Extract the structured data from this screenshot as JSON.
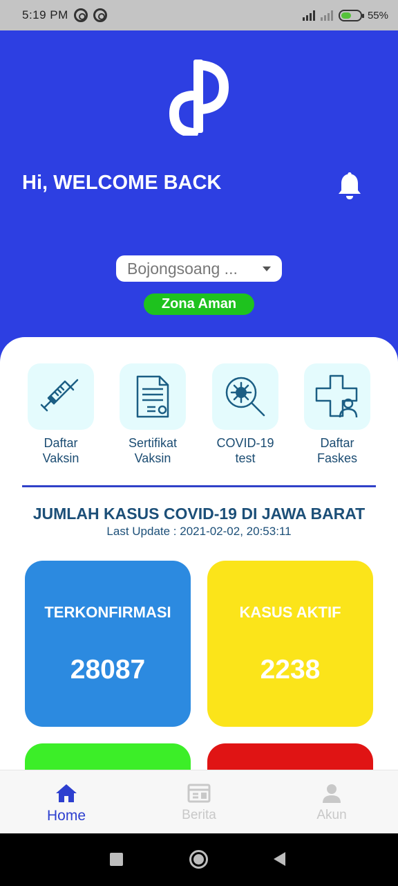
{
  "status_bar": {
    "time": "5:19 PM",
    "battery": "55%",
    "battery_level": 0.55
  },
  "hero": {
    "greeting": "Hi, WELCOME BACK",
    "location": "Bojongsoang ...",
    "zone_label": "Zona Aman",
    "colors": {
      "background": "#2d3fe2",
      "zone": "#1ec21e"
    }
  },
  "menu": [
    {
      "label": "Daftar\nVaksin",
      "icon": "syringe-icon"
    },
    {
      "label": "Sertifikat\nVaksin",
      "icon": "certificate-icon"
    },
    {
      "label": "COVID-19\ntest",
      "icon": "virus-search-icon"
    },
    {
      "label": "Daftar\nFaskes",
      "icon": "hospital-cross-icon"
    }
  ],
  "covid": {
    "title": "JUMLAH KASUS COVID-19 DI JAWA BARAT",
    "last_update": "Last Update : 2021-02-02, 20:53:11",
    "stats": [
      {
        "label": "TERKONFIRMASI",
        "value": "28087",
        "color": "#2c8ae0"
      },
      {
        "label": "KASUS AKTIF",
        "value": "2238",
        "color": "#fbe41a"
      },
      {
        "label": "",
        "value": "",
        "color": "#3cee28"
      },
      {
        "label": "",
        "value": "",
        "color": "#e01414"
      }
    ]
  },
  "bottom_nav": [
    {
      "label": "Home",
      "icon": "home-icon",
      "active": true
    },
    {
      "label": "Berita",
      "icon": "news-icon",
      "active": false
    },
    {
      "label": "Akun",
      "icon": "user-icon",
      "active": false
    }
  ]
}
